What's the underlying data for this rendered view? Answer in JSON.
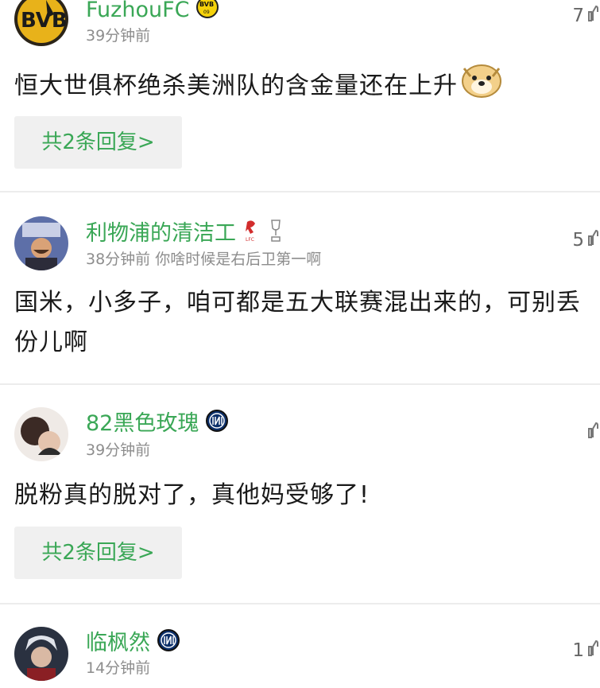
{
  "comments": [
    {
      "username": "FuzhouFC",
      "badge_icon": "bvb-crest-icon",
      "time": "39分钟前",
      "reply_to": "",
      "likes": "7",
      "text": "恒大世俱杯绝杀美洲队的含金量还在上升",
      "emoji_icon": "doge-emoji-icon",
      "reply_label": "共2条回复>"
    },
    {
      "username": "利物浦的清洁工",
      "badge_icon": "liverpool-crest-icon",
      "badge2_icon": "trophy-icon",
      "time": "38分钟前",
      "reply_to": "你啥时候是右后卫第一啊",
      "likes": "5",
      "text": "国米，小多子，咱可都是五大联赛混出来的，可别丢份儿啊"
    },
    {
      "username": "82黑色玫瑰",
      "badge_icon": "inter-crest-icon",
      "time": "39分钟前",
      "likes": "",
      "text": "脱粉真的脱对了，真他妈受够了!",
      "reply_label": "共2条回复>"
    },
    {
      "username": "临枫然",
      "badge_icon": "inter-crest-icon",
      "time": "14分钟前",
      "likes": "1"
    }
  ],
  "colors": {
    "accent": "#3aa756",
    "meta": "#8d8d8d",
    "reply_bg": "#f0f0f0"
  }
}
